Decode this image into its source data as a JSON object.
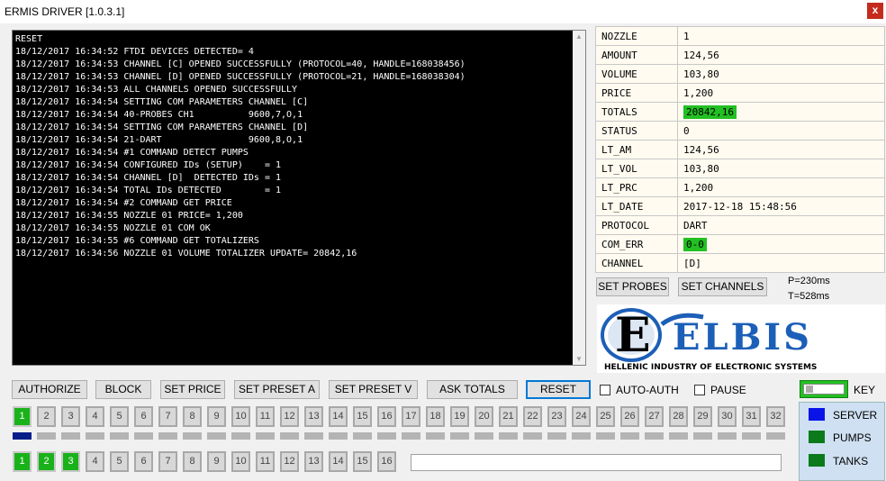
{
  "window": {
    "title": "ERMIS DRIVER [1.0.3.1]",
    "close_label": "x"
  },
  "console": {
    "lines": [
      "RESET",
      "18/12/2017 16:34:52 FTDI DEVICES DETECTED= 4",
      "18/12/2017 16:34:53 CHANNEL [C] OPENED SUCCESSFULLY (PROTOCOL=40, HANDLE=168038456)",
      "18/12/2017 16:34:53 CHANNEL [D] OPENED SUCCESSFULLY (PROTOCOL=21, HANDLE=168038304)",
      "18/12/2017 16:34:53 ALL CHANNELS OPENED SUCCESSFULLY",
      "18/12/2017 16:34:54 SETTING COM PARAMETERS CHANNEL [C]",
      "18/12/2017 16:34:54 40-PROBES CH1          9600,7,O,1",
      "18/12/2017 16:34:54 SETTING COM PARAMETERS CHANNEL [D]",
      "18/12/2017 16:34:54 21-DART                9600,8,O,1",
      "18/12/2017 16:34:54 #1 COMMAND DETECT PUMPS",
      "18/12/2017 16:34:54 CONFIGURED IDs (SETUP)    = 1",
      "18/12/2017 16:34:54 CHANNEL [D]  DETECTED IDs = 1",
      "18/12/2017 16:34:54 TOTAL IDs DETECTED        = 1",
      "18/12/2017 16:34:54 #2 COMMAND GET PRICE",
      "18/12/2017 16:34:55 NOZZLE 01 PRICE= 1,200",
      "18/12/2017 16:34:55 NOZZLE 01 COM OK",
      "18/12/2017 16:34:55 #6 COMMAND GET TOTALIZERS",
      "18/12/2017 16:34:56 NOZZLE 01 VOLUME TOTALIZER UPDATE= 20842,16"
    ]
  },
  "info": {
    "rows": [
      {
        "key": "NOZZLE",
        "value": "1"
      },
      {
        "key": "AMOUNT",
        "value": "124,56"
      },
      {
        "key": "VOLUME",
        "value": "103,80"
      },
      {
        "key": "PRICE",
        "value": "1,200"
      },
      {
        "key": "TOTALS",
        "value": "20842,16",
        "highlight": true
      },
      {
        "key": "STATUS",
        "value": "0"
      },
      {
        "key": "LT_AM",
        "value": "124,56"
      },
      {
        "key": "LT_VOL",
        "value": "103,80"
      },
      {
        "key": "LT_PRC",
        "value": "1,200"
      },
      {
        "key": "LT_DATE",
        "value": "2017-12-18 15:48:56"
      },
      {
        "key": "PROTOCOL",
        "value": "DART"
      },
      {
        "key": "COM_ERR",
        "value": "0-0",
        "highlight": true
      },
      {
        "key": "CHANNEL",
        "value": "[D]"
      }
    ]
  },
  "buttons": {
    "set_probes": "SET PROBES",
    "set_channels": "SET CHANNELS",
    "authorize": "AUTHORIZE",
    "block": "BLOCK",
    "set_price": "SET PRICE",
    "set_preset_a": "SET PRESET A",
    "set_preset_v": "SET PRESET V",
    "ask_totals": "ASK TOTALS",
    "reset": "RESET"
  },
  "timing": {
    "p": "P=230ms",
    "t": "T=528ms"
  },
  "logo": {
    "brand": "ELBIS",
    "letter": "E",
    "tagline": "HELLENIC INDUSTRY OF ELECTRONIC SYSTEMS"
  },
  "options": {
    "auto_auth": "AUTO-AUTH",
    "pause": "PAUSE",
    "key": "KEY"
  },
  "pumps": {
    "labels": [
      "1",
      "2",
      "3",
      "4",
      "5",
      "6",
      "7",
      "8",
      "9",
      "10",
      "11",
      "12",
      "13",
      "14",
      "15",
      "16",
      "17",
      "18",
      "19",
      "20",
      "21",
      "22",
      "23",
      "24",
      "25",
      "26",
      "27",
      "28",
      "29",
      "30",
      "31",
      "32"
    ],
    "active": [
      true,
      false,
      false,
      false,
      false,
      false,
      false,
      false,
      false,
      false,
      false,
      false,
      false,
      false,
      false,
      false,
      false,
      false,
      false,
      false,
      false,
      false,
      false,
      false,
      false,
      false,
      false,
      false,
      false,
      false,
      false,
      false
    ],
    "indicator_on": [
      true,
      false,
      false,
      false,
      false,
      false,
      false,
      false,
      false,
      false,
      false,
      false,
      false,
      false,
      false,
      false,
      false,
      false,
      false,
      false,
      false,
      false,
      false,
      false,
      false,
      false,
      false,
      false,
      false,
      false,
      false,
      false
    ]
  },
  "tanks": {
    "labels": [
      "1",
      "2",
      "3",
      "4",
      "5",
      "6",
      "7",
      "8",
      "9",
      "10",
      "11",
      "12",
      "13",
      "14",
      "15",
      "16"
    ],
    "active": [
      true,
      true,
      true,
      false,
      false,
      false,
      false,
      false,
      false,
      false,
      false,
      false,
      false,
      false,
      false,
      false
    ]
  },
  "status_field": {
    "value": ""
  },
  "legend": {
    "items": [
      {
        "label": "SERVER",
        "color": "#0a14e8"
      },
      {
        "label": "PUMPS",
        "color": "#0a7a1a"
      },
      {
        "label": "TANKS",
        "color": "#0a7a1a"
      }
    ]
  },
  "colors": {
    "active_green": "#1ab21a",
    "highlight_green": "#22c022",
    "indicator_blue": "#0a1e8a",
    "focus_blue": "#0078d7"
  }
}
